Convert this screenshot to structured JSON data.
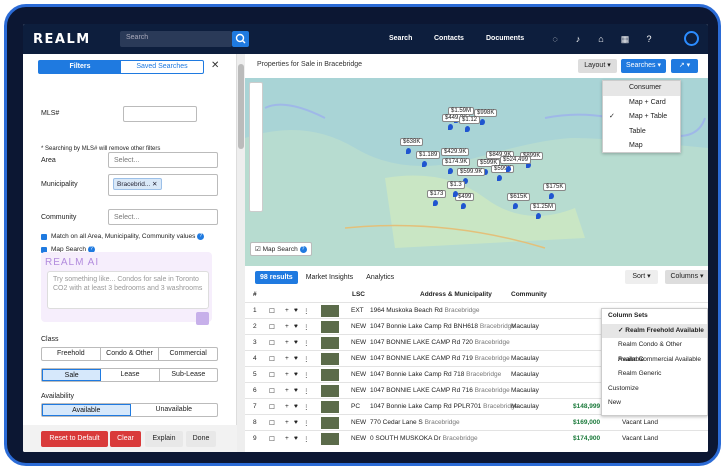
{
  "topnav": {
    "logo": "REALM",
    "search_placeholder": "Search",
    "links": [
      "Search",
      "Contacts",
      "Documents"
    ]
  },
  "filters": {
    "tab_filters": "Filters",
    "tab_saved": "Saved Searches",
    "mls_label": "MLS#",
    "mls_note": "* Searching by MLS# will remove other filters",
    "area_label": "Area",
    "area_placeholder": "Select...",
    "municipality_label": "Municipality",
    "municipality_chip": "Bracebrid...",
    "community_label": "Community",
    "community_placeholder": "Select...",
    "match_all": "Match on all Area, Municipality, Community values",
    "map_search": "Map Search",
    "ai_logo": "REALM AI",
    "ai_placeholder": "Try something like... Condos for sale in Toronto CO2 with at least 3 bedrooms and 3 washrooms",
    "class_label": "Class",
    "class_options": [
      "Freehold",
      "Condo & Other",
      "Commercial"
    ],
    "type_options": [
      "Sale",
      "Lease",
      "Sub-Lease"
    ],
    "availability_label": "Availability",
    "availability_options": [
      "Available",
      "Unavailable"
    ],
    "buttons": {
      "reset": "Reset to Default",
      "clear": "Clear",
      "explain": "Explain",
      "done": "Done"
    }
  },
  "main": {
    "title": "Properties for Sale in Bracebridge",
    "layout_btn": "Layout",
    "searches_btn": "Searches",
    "layout_options": [
      "Consumer",
      "Map + Card",
      "Map + Table",
      "Table",
      "Map"
    ],
    "layout_selected": "Map + Table",
    "map_search_label": "Map Search",
    "map_pins": [
      "$1.59M",
      "$998K",
      "$449.9K",
      "$1.12",
      "$638K",
      "$429.9K",
      "$849.9K",
      "$1.189",
      "$174.9K",
      "$599K",
      "$899K",
      "$599K",
      "$599.9K",
      "$524,499",
      "$175K",
      "$1.25M",
      "$615K",
      "$173",
      "$499",
      "$1.3"
    ]
  },
  "results": {
    "count_tab": "98 results",
    "tabs": [
      "Market Insights",
      "Analytics"
    ],
    "sort_btn": "Sort",
    "columns_btn": "Columns",
    "headers": [
      "#",
      "LSC",
      "Address & Municipality",
      "Community"
    ],
    "rows": [
      {
        "n": "1",
        "lsc": "EXT",
        "addr": "1964 Muskoka Beach Rd",
        "muni": "Bracebridge",
        "comm": "",
        "price": "",
        "type": ""
      },
      {
        "n": "2",
        "lsc": "NEW",
        "addr": "1047 Bonnie Lake Camp Rd BNH618",
        "muni": "Bracebridge",
        "comm": "Macaulay",
        "price": "",
        "type": ""
      },
      {
        "n": "3",
        "lsc": "NEW",
        "addr": "1047 BONNIE LAKE CAMP Rd 720",
        "muni": "Bracebridge",
        "comm": "",
        "price": "",
        "type": ""
      },
      {
        "n": "4",
        "lsc": "NEW",
        "addr": "1047 BONNIE LAKE CAMP Rd 719",
        "muni": "Bracebridge",
        "comm": "Macaulay",
        "price": "",
        "type": ""
      },
      {
        "n": "5",
        "lsc": "NEW",
        "addr": "1047 Bonnie Lake Camp Rd 718",
        "muni": "Bracebridge",
        "comm": "Macaulay",
        "price": "",
        "type": ""
      },
      {
        "n": "6",
        "lsc": "NEW",
        "addr": "1047 BONNIE LAKE CAMP Rd 716",
        "muni": "Bracebridge",
        "comm": "Macaulay",
        "price": "",
        "type": ""
      },
      {
        "n": "7",
        "lsc": "PC",
        "addr": "1047 Bonnie Lake Camp Rd PPLR701",
        "muni": "Bracebridge",
        "comm": "Macaulay",
        "price": "$148,999",
        "type": "Mobile/Trailer Bungalow"
      },
      {
        "n": "8",
        "lsc": "NEW",
        "addr": "770 Cedar Lane S",
        "muni": "Bracebridge",
        "comm": "",
        "price": "$169,000",
        "type": "Vacant Land"
      },
      {
        "n": "9",
        "lsc": "NEW",
        "addr": "0 SOUTH MUSKOKA Dr",
        "muni": "Bracebridge",
        "comm": "",
        "price": "$174,900",
        "type": "Vacant Land"
      }
    ],
    "column_sets_title": "Column Sets",
    "column_sets": [
      "Realm Freehold Available",
      "Realm Condo & Other Available",
      "Realm Commercial Available",
      "Realm Generic"
    ],
    "column_sets_extra": [
      "Customize",
      "New"
    ]
  }
}
